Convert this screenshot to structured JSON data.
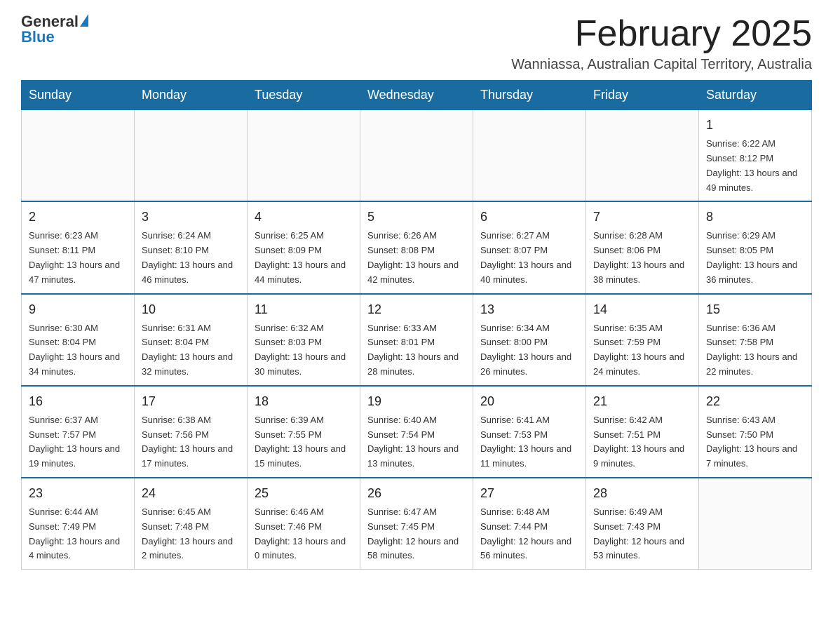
{
  "header": {
    "logo": {
      "general": "General",
      "blue": "Blue"
    },
    "title": "February 2025",
    "location": "Wanniassa, Australian Capital Territory, Australia"
  },
  "days_of_week": [
    "Sunday",
    "Monday",
    "Tuesday",
    "Wednesday",
    "Thursday",
    "Friday",
    "Saturday"
  ],
  "weeks": [
    [
      {
        "day": "",
        "info": ""
      },
      {
        "day": "",
        "info": ""
      },
      {
        "day": "",
        "info": ""
      },
      {
        "day": "",
        "info": ""
      },
      {
        "day": "",
        "info": ""
      },
      {
        "day": "",
        "info": ""
      },
      {
        "day": "1",
        "info": "Sunrise: 6:22 AM\nSunset: 8:12 PM\nDaylight: 13 hours and 49 minutes."
      }
    ],
    [
      {
        "day": "2",
        "info": "Sunrise: 6:23 AM\nSunset: 8:11 PM\nDaylight: 13 hours and 47 minutes."
      },
      {
        "day": "3",
        "info": "Sunrise: 6:24 AM\nSunset: 8:10 PM\nDaylight: 13 hours and 46 minutes."
      },
      {
        "day": "4",
        "info": "Sunrise: 6:25 AM\nSunset: 8:09 PM\nDaylight: 13 hours and 44 minutes."
      },
      {
        "day": "5",
        "info": "Sunrise: 6:26 AM\nSunset: 8:08 PM\nDaylight: 13 hours and 42 minutes."
      },
      {
        "day": "6",
        "info": "Sunrise: 6:27 AM\nSunset: 8:07 PM\nDaylight: 13 hours and 40 minutes."
      },
      {
        "day": "7",
        "info": "Sunrise: 6:28 AM\nSunset: 8:06 PM\nDaylight: 13 hours and 38 minutes."
      },
      {
        "day": "8",
        "info": "Sunrise: 6:29 AM\nSunset: 8:05 PM\nDaylight: 13 hours and 36 minutes."
      }
    ],
    [
      {
        "day": "9",
        "info": "Sunrise: 6:30 AM\nSunset: 8:04 PM\nDaylight: 13 hours and 34 minutes."
      },
      {
        "day": "10",
        "info": "Sunrise: 6:31 AM\nSunset: 8:04 PM\nDaylight: 13 hours and 32 minutes."
      },
      {
        "day": "11",
        "info": "Sunrise: 6:32 AM\nSunset: 8:03 PM\nDaylight: 13 hours and 30 minutes."
      },
      {
        "day": "12",
        "info": "Sunrise: 6:33 AM\nSunset: 8:01 PM\nDaylight: 13 hours and 28 minutes."
      },
      {
        "day": "13",
        "info": "Sunrise: 6:34 AM\nSunset: 8:00 PM\nDaylight: 13 hours and 26 minutes."
      },
      {
        "day": "14",
        "info": "Sunrise: 6:35 AM\nSunset: 7:59 PM\nDaylight: 13 hours and 24 minutes."
      },
      {
        "day": "15",
        "info": "Sunrise: 6:36 AM\nSunset: 7:58 PM\nDaylight: 13 hours and 22 minutes."
      }
    ],
    [
      {
        "day": "16",
        "info": "Sunrise: 6:37 AM\nSunset: 7:57 PM\nDaylight: 13 hours and 19 minutes."
      },
      {
        "day": "17",
        "info": "Sunrise: 6:38 AM\nSunset: 7:56 PM\nDaylight: 13 hours and 17 minutes."
      },
      {
        "day": "18",
        "info": "Sunrise: 6:39 AM\nSunset: 7:55 PM\nDaylight: 13 hours and 15 minutes."
      },
      {
        "day": "19",
        "info": "Sunrise: 6:40 AM\nSunset: 7:54 PM\nDaylight: 13 hours and 13 minutes."
      },
      {
        "day": "20",
        "info": "Sunrise: 6:41 AM\nSunset: 7:53 PM\nDaylight: 13 hours and 11 minutes."
      },
      {
        "day": "21",
        "info": "Sunrise: 6:42 AM\nSunset: 7:51 PM\nDaylight: 13 hours and 9 minutes."
      },
      {
        "day": "22",
        "info": "Sunrise: 6:43 AM\nSunset: 7:50 PM\nDaylight: 13 hours and 7 minutes."
      }
    ],
    [
      {
        "day": "23",
        "info": "Sunrise: 6:44 AM\nSunset: 7:49 PM\nDaylight: 13 hours and 4 minutes."
      },
      {
        "day": "24",
        "info": "Sunrise: 6:45 AM\nSunset: 7:48 PM\nDaylight: 13 hours and 2 minutes."
      },
      {
        "day": "25",
        "info": "Sunrise: 6:46 AM\nSunset: 7:46 PM\nDaylight: 13 hours and 0 minutes."
      },
      {
        "day": "26",
        "info": "Sunrise: 6:47 AM\nSunset: 7:45 PM\nDaylight: 12 hours and 58 minutes."
      },
      {
        "day": "27",
        "info": "Sunrise: 6:48 AM\nSunset: 7:44 PM\nDaylight: 12 hours and 56 minutes."
      },
      {
        "day": "28",
        "info": "Sunrise: 6:49 AM\nSunset: 7:43 PM\nDaylight: 12 hours and 53 minutes."
      },
      {
        "day": "",
        "info": ""
      }
    ]
  ]
}
